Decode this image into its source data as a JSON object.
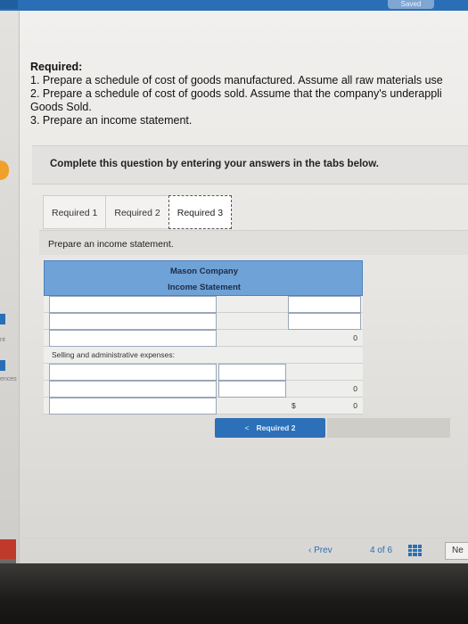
{
  "header": {
    "saved_label": "Saved"
  },
  "sidebar_fragments": {
    "item_a": "nt",
    "item_b": "ences"
  },
  "required": {
    "heading": "Required:",
    "items": [
      "1. Prepare a schedule of cost of goods manufactured. Assume all raw materials use",
      "2. Prepare a schedule of cost of goods sold. Assume that the company's underappli",
      "Goods Sold.",
      "3. Prepare an income statement."
    ]
  },
  "instruction": "Complete this question by entering your answers in the tabs below.",
  "tabs": [
    {
      "label": "Required 1",
      "active": false
    },
    {
      "label": "Required 2",
      "active": false
    },
    {
      "label": "Required 3",
      "active": true
    }
  ],
  "prompt": "Prepare an income statement.",
  "statement": {
    "company": "Mason Company",
    "title": "Income Statement",
    "rows": [
      {
        "label": "",
        "mid": "",
        "right": ""
      },
      {
        "label": "",
        "mid": "",
        "right": ""
      },
      {
        "label": "",
        "mid": "",
        "right": "0"
      },
      {
        "label": "Selling and administrative expenses:",
        "mid": "",
        "right": ""
      },
      {
        "label": "",
        "mid": "",
        "right": ""
      },
      {
        "label": "",
        "mid": "",
        "right": "0"
      },
      {
        "label": "",
        "mid": "",
        "right": "0",
        "currency": "$"
      }
    ]
  },
  "nav": {
    "chevron": "<",
    "back_label": "Required 2"
  },
  "footer": {
    "prev_label": "Prev",
    "page_indicator": "4 of 6",
    "next_label": "Ne"
  },
  "colors": {
    "accent": "#2a6fb5",
    "table_header": "#6fa2d6"
  }
}
